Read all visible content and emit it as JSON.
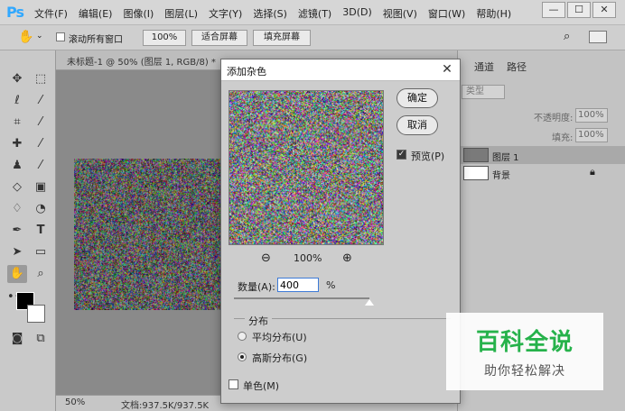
{
  "app": {
    "logo": "Ps",
    "menu": [
      "文件(F)",
      "编辑(E)",
      "图像(I)",
      "图层(L)",
      "文字(Y)",
      "选择(S)",
      "滤镜(T)",
      "3D(D)",
      "视图(V)",
      "窗口(W)",
      "帮助(H)"
    ],
    "window_controls": [
      "—",
      "☐",
      "✕"
    ]
  },
  "options_bar": {
    "scroll_all_label": "滚动所有窗口",
    "zoom_label": "100%",
    "fit_screen_label": "适合屏幕",
    "fill_screen_label": "填充屏幕"
  },
  "document": {
    "tab_title": "未标题-1 @ 50% (图层 1, RGB/8) *",
    "zoom": "50%",
    "doc_info": "文档:937.5K/937.5K"
  },
  "right_panel": {
    "tabs": [
      "通道",
      "路径"
    ],
    "kind_placeholder": "类型",
    "opacity_label": "不透明度:",
    "opacity_value": "100%",
    "fill_label": "填充:",
    "fill_value": "100%",
    "layers": [
      {
        "name": "图层 1"
      },
      {
        "name": "背景"
      }
    ]
  },
  "dialog": {
    "title": "添加杂色",
    "ok_label": "确定",
    "cancel_label": "取消",
    "preview_label": "预览(P)",
    "preview_checked": true,
    "zoom_value": "100%",
    "amount_label": "数量(A):",
    "amount_value": "400",
    "amount_unit": "%",
    "amount_slider_fraction": 1.0,
    "distribution_label": "分布",
    "uniform_label": "平均分布(U)",
    "gaussian_label": "高斯分布(G)",
    "selected_distribution": "gaussian",
    "mono_label": "单色(M)",
    "mono_checked": false
  },
  "watermark": {
    "main": "百科全说",
    "sub": "助你轻松解决"
  },
  "colors": {
    "watermark_green": "#26b24b",
    "ps_blue": "#31a8ff",
    "input_focus": "#3d7ad6"
  }
}
